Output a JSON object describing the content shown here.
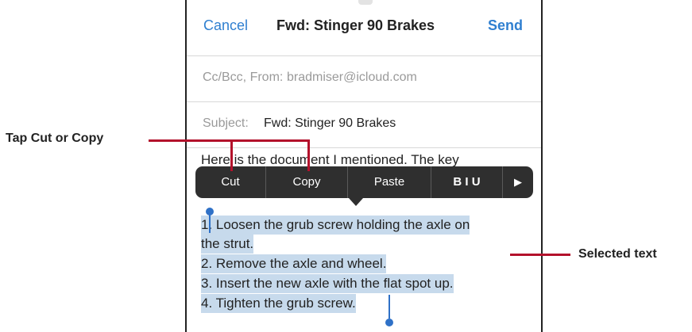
{
  "nav": {
    "cancel": "Cancel",
    "title": "Fwd: Stinger 90 Brakes",
    "send": "Send"
  },
  "fields": {
    "cc_label": "Cc/Bcc, From:",
    "cc_value": "bradmiser@icloud.com",
    "subject_label": "Subject:",
    "subject_value": "Fwd: Stinger 90 Brakes"
  },
  "body": {
    "first_line": "Here is the document I mentioned. The key",
    "selected_lines": [
      "1. Loosen the grub screw holding the axle on",
      "the strut.",
      "2. Remove the axle and wheel.",
      "3. Insert the new axle with the flat spot up.",
      "4. Tighten the grub screw."
    ]
  },
  "edit_menu": {
    "items": [
      "Cut",
      "Copy",
      "Paste",
      "B I U",
      "▶"
    ]
  },
  "callouts": {
    "cut_copy": "Tap Cut or Copy",
    "selected": "Selected text"
  },
  "colors": {
    "accent": "#2f7fd0",
    "callout_line": "#b3112b",
    "selection": "#c7daec"
  }
}
